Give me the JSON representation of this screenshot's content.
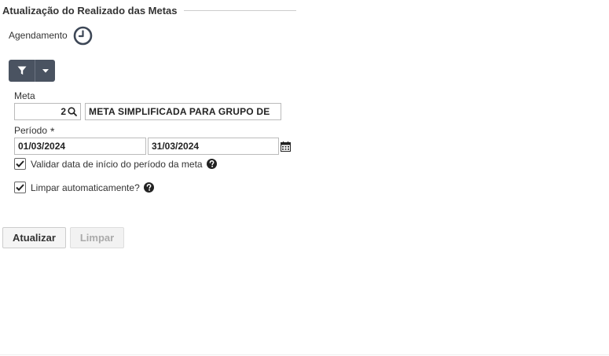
{
  "header": {
    "title": "Atualização do Realizado das Metas"
  },
  "schedule": {
    "label": "Agendamento",
    "icon": "clock-icon"
  },
  "toolbar": {
    "filter_icon": "filter-icon",
    "caret_icon": "caret-down-icon"
  },
  "form": {
    "meta_label": "Meta",
    "meta_code": "2",
    "meta_description": "META SIMPLIFICADA PARA GRUPO DE",
    "periodo_label": "Período",
    "required_marker": "*",
    "date_start": "01/03/2024",
    "date_end": "31/03/2024",
    "check_validar": {
      "label": "Validar data de início do período da meta",
      "checked": true
    },
    "check_limpar": {
      "label": "Limpar automaticamente?",
      "checked": true
    }
  },
  "buttons": {
    "atualizar": "Atualizar",
    "limpar": "Limpar"
  },
  "colors": {
    "toolbar_bg": "#4a5361",
    "text": "#333333",
    "border": "#bbbbbb"
  }
}
